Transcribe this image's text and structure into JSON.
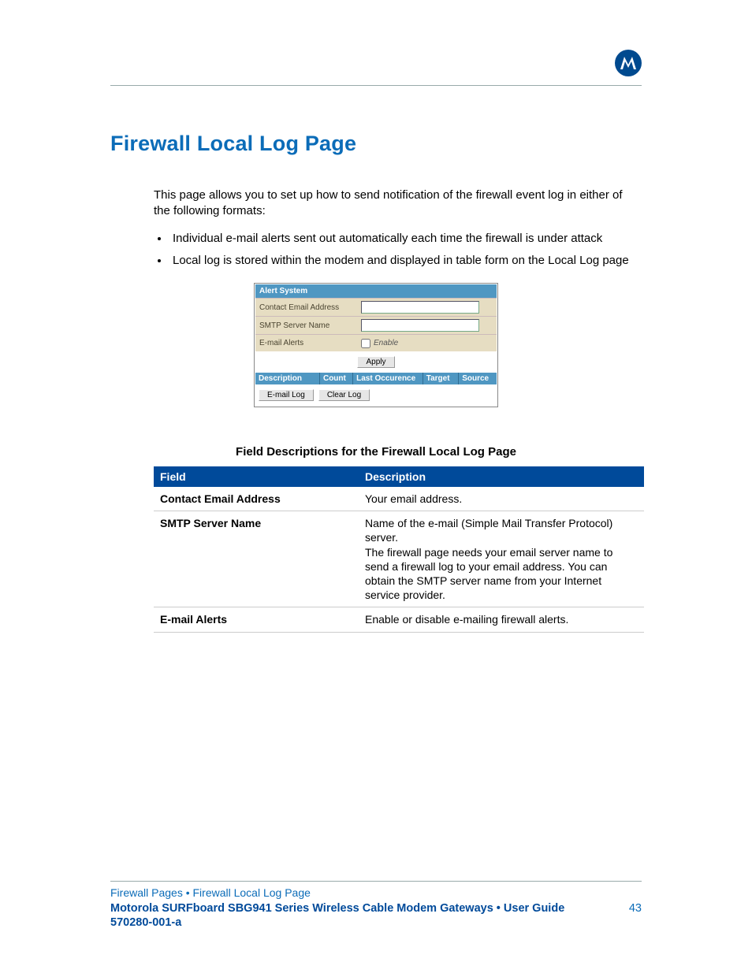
{
  "heading": "Firewall Local Log Page",
  "intro": "This page allows you to set up how to send notification of the firewall event log in either of the following formats:",
  "bullets": [
    "Individual e-mail alerts sent out automatically each time the firewall is under attack",
    "Local log is stored within the modem and displayed in table form on the Local Log page"
  ],
  "shot": {
    "alert_header": "Alert System",
    "rows": {
      "contact_label": "Contact Email Address",
      "smtp_label": "SMTP Server Name",
      "alerts_label": "E-mail Alerts",
      "enable_label": "Enable"
    },
    "apply_btn": "Apply",
    "log_cols": [
      "Description",
      "Count",
      "Last Occurence",
      "Target",
      "Source"
    ],
    "email_log_btn": "E-mail Log",
    "clear_log_btn": "Clear Log"
  },
  "caption": "Field Descriptions for the Firewall Local Log Page",
  "table": {
    "head_field": "Field",
    "head_desc": "Description",
    "rows": [
      {
        "field": "Contact Email Address",
        "desc": "Your email address."
      },
      {
        "field": "SMTP Server Name",
        "desc": "Name of the e-mail (Simple Mail Transfer Protocol) server.\nThe firewall page needs your email server name to send a firewall log to your email address. You can obtain the SMTP server name from your Internet service provider."
      },
      {
        "field": "E-mail Alerts",
        "desc": "Enable or disable e-mailing firewall alerts."
      }
    ]
  },
  "footer": {
    "crumb": "Firewall Pages • Firewall Local Log Page",
    "guide": "Motorola SURFboard SBG941 Series Wireless Cable Modem Gateways • User Guide",
    "page_num": "43",
    "docnum": "570280-001-a"
  }
}
